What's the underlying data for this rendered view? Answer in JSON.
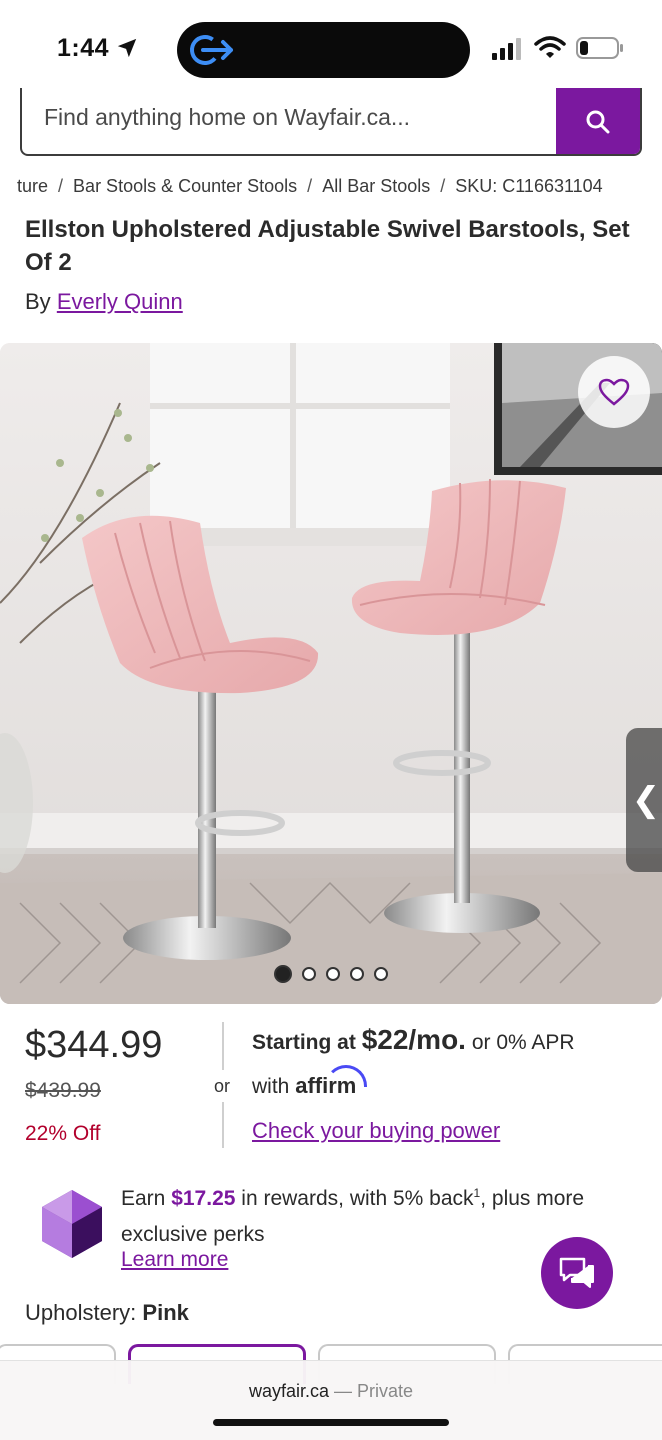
{
  "status_bar": {
    "time": "1:44",
    "icons": [
      "location-arrow-icon",
      "screen-mirroring-icon",
      "cellular-signal-icon",
      "wifi-icon",
      "battery-icon"
    ]
  },
  "search": {
    "placeholder": "Find anything home on Wayfair.ca...",
    "button_icon": "search-icon"
  },
  "breadcrumb": [
    "ture",
    "Bar Stools & Counter Stools",
    "All Bar Stools",
    "SKU: C116631104"
  ],
  "product": {
    "title": "Ellston Upholstered Adjustable Swivel Barstools, Set Of 2",
    "by_label": "By",
    "brand": "Everly Quinn"
  },
  "gallery": {
    "image_alt": "two pink velvet swivel bar stools",
    "total_images": 5,
    "active_index": 0,
    "favorite_icon": "heart-icon",
    "next_icon": "chevron-left-icon"
  },
  "pricing": {
    "price": "$344.99",
    "original_price": "$439.99",
    "discount": "22% Off",
    "or": "or",
    "financing_prefix": "Starting at",
    "financing_amount": "$22/mo.",
    "financing_suffix": "or 0% APR",
    "with_label": "with",
    "affirm_brand": "affirm",
    "buying_power_link": "Check your buying power"
  },
  "rewards": {
    "text_prefix": "Earn",
    "amount": "$17.25",
    "text_mid": "in rewards, with 5% back",
    "footnote": "1",
    "text_suffix": ", plus more exclusive perks",
    "learn_more": "Learn more"
  },
  "options": {
    "label": "Upholstery:",
    "selected_value": "Pink"
  },
  "browser": {
    "domain": "wayfair.ca",
    "mode": "— Private"
  },
  "colors": {
    "brand_purple": "#7b189f",
    "discount_red": "#b2002c",
    "affirm_blue": "#4a4af4"
  }
}
